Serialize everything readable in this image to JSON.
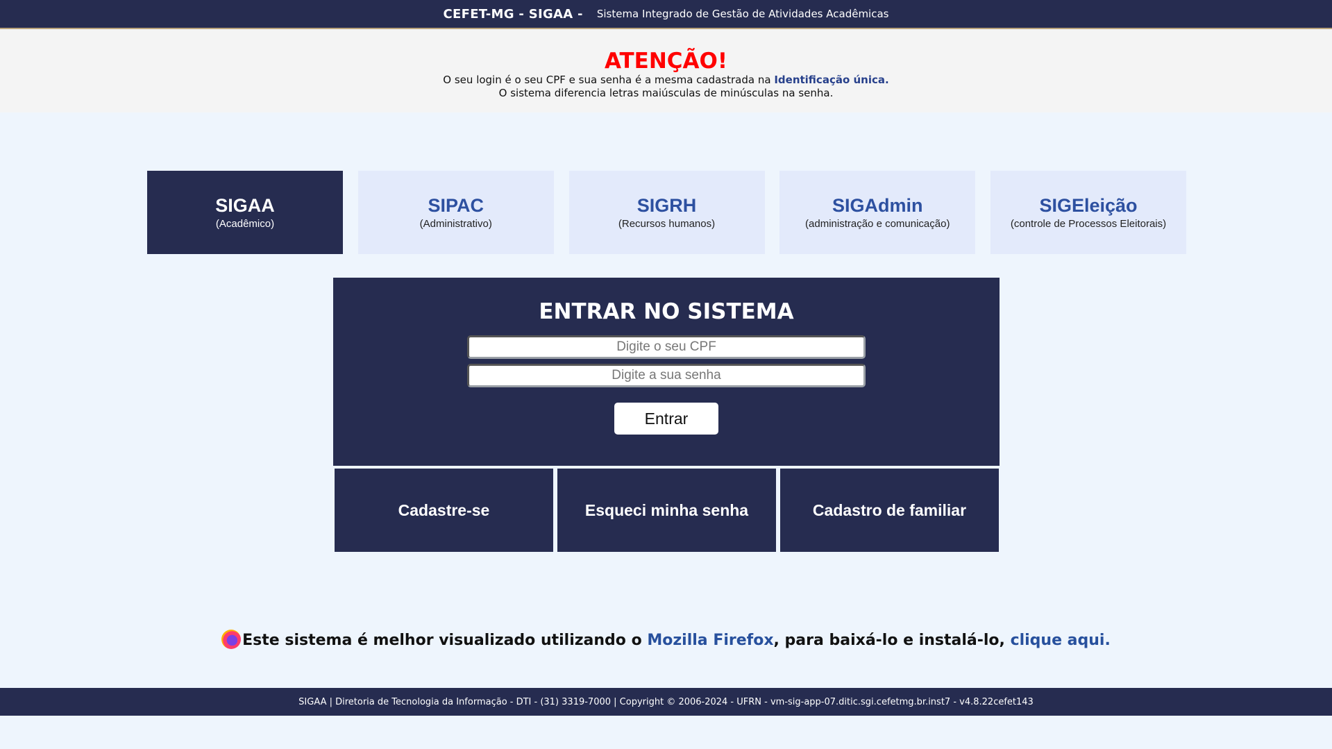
{
  "header": {
    "brand": "CEFET-MG - SIGAA -",
    "subtitle": "Sistema Integrado de Gestão de Atividades Acadêmicas"
  },
  "attention": {
    "title": "ATENÇÃO!",
    "line1_prefix": "O seu login é o seu CPF e sua senha é a mesma cadastrada na",
    "line1_link": "Identificação única.",
    "line2": "O sistema diferencia letras maiúsculas de minúsculas na senha."
  },
  "systems": [
    {
      "name": "SIGAA",
      "desc": "(Acadêmico)",
      "active": true
    },
    {
      "name": "SIPAC",
      "desc": "(Administrativo)",
      "active": false
    },
    {
      "name": "SIGRH",
      "desc": "(Recursos humanos)",
      "active": false
    },
    {
      "name": "SIGAdmin",
      "desc": "(administração e comunicação)",
      "active": false
    },
    {
      "name": "SIGEleição",
      "desc": "(controle de Processos Eleitorais)",
      "active": false
    }
  ],
  "login": {
    "heading": "ENTRAR NO SISTEMA",
    "cpf_placeholder": "Digite o seu CPF",
    "password_placeholder": "Digite a sua senha",
    "submit_label": "Entrar"
  },
  "actions": {
    "register": "Cadastre-se",
    "forgot": "Esqueci minha senha",
    "family": "Cadastro de familiar"
  },
  "firefox_note": {
    "icon": "firefox-icon",
    "text_prefix": "Este sistema é melhor visualizado utilizando o",
    "browser_link": "Mozilla Firefox",
    "text_middle": ", para baixá-lo e instalá-lo,",
    "download_link": "clique aqui."
  },
  "footer": {
    "text": "SIGAA | Diretoria de Tecnologia da Informação - DTI - (31) 3319-7000 | Copyright © 2006-2024 - UFRN - vm-sig-app-07.ditic.sgi.cefetmg.br.inst7 - v4.8.22cefet143"
  },
  "colors": {
    "navy": "#262c50",
    "card_light": "#e3eafb",
    "link_blue": "#27408b",
    "alert_red": "#ff0000",
    "page_bg": "#eef5fd"
  }
}
